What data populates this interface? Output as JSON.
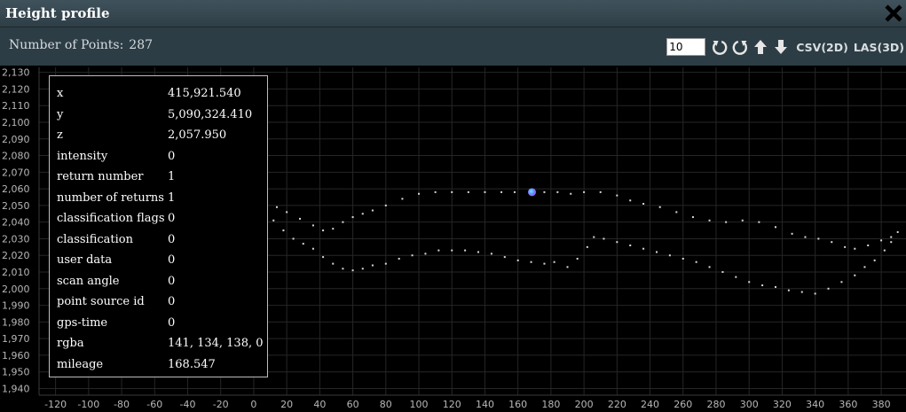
{
  "window": {
    "title": "Height profile",
    "close_icon": "close-icon"
  },
  "toolbar": {
    "points_label": "Number of Points:",
    "points_value": "287",
    "step_value": "10",
    "rotate_cw_icon": "rotate-clockwise-icon",
    "rotate_ccw_icon": "rotate-counterclockwise-icon",
    "move_up_icon": "arrow-up-icon",
    "move_down_icon": "arrow-down-icon",
    "csv_label": "CSV(2D)",
    "las_label": "LAS(3D)"
  },
  "chart_data": {
    "type": "scatter",
    "xlim": [
      -130,
      395
    ],
    "ylim": [
      1936,
      2133
    ],
    "x_ticks": [
      -120,
      -100,
      -80,
      -60,
      -40,
      -20,
      0,
      20,
      40,
      60,
      80,
      100,
      120,
      140,
      160,
      180,
      200,
      220,
      240,
      260,
      280,
      300,
      320,
      340,
      360,
      380
    ],
    "y_ticks": [
      1940,
      1950,
      1960,
      1970,
      1980,
      1990,
      2000,
      2010,
      2020,
      2030,
      2040,
      2050,
      2060,
      2070,
      2080,
      2090,
      2100,
      2110,
      2120,
      2130
    ],
    "grid": true,
    "series": [
      {
        "values": [
          [
            2,
            2067
          ],
          [
            8,
            2055
          ],
          [
            14,
            2049
          ],
          [
            20,
            2046
          ],
          [
            28,
            2042
          ],
          [
            36,
            2038
          ],
          [
            42,
            2035
          ],
          [
            48,
            2036
          ],
          [
            54,
            2040
          ],
          [
            60,
            2043
          ],
          [
            66,
            2045
          ],
          [
            72,
            2047
          ],
          [
            80,
            2050
          ],
          [
            90,
            2054
          ],
          [
            100,
            2057
          ],
          [
            110,
            2058
          ],
          [
            120,
            2058
          ],
          [
            130,
            2058
          ],
          [
            140,
            2058
          ],
          [
            150,
            2058
          ],
          [
            158,
            2058
          ],
          [
            168,
            2058
          ],
          [
            176,
            2058
          ],
          [
            184,
            2058
          ],
          [
            192,
            2057
          ],
          [
            200,
            2058
          ],
          [
            210,
            2058
          ],
          [
            220,
            2056
          ],
          [
            228,
            2053
          ],
          [
            236,
            2051
          ],
          [
            246,
            2049
          ],
          [
            256,
            2046
          ],
          [
            266,
            2043
          ],
          [
            276,
            2041
          ],
          [
            286,
            2040
          ],
          [
            296,
            2041
          ],
          [
            306,
            2040
          ],
          [
            316,
            2037
          ],
          [
            326,
            2033
          ],
          [
            334,
            2031
          ],
          [
            342,
            2030
          ],
          [
            350,
            2028
          ],
          [
            358,
            2025
          ],
          [
            364,
            2024
          ],
          [
            372,
            2026
          ],
          [
            380,
            2029
          ],
          [
            386,
            2031
          ]
        ]
      },
      {
        "values": [
          [
            6,
            2050
          ],
          [
            12,
            2041
          ],
          [
            18,
            2035
          ],
          [
            24,
            2030
          ],
          [
            30,
            2027
          ],
          [
            36,
            2024
          ],
          [
            42,
            2019
          ],
          [
            48,
            2015
          ],
          [
            54,
            2012
          ],
          [
            60,
            2011
          ],
          [
            66,
            2012
          ],
          [
            72,
            2014
          ],
          [
            80,
            2015
          ],
          [
            88,
            2018
          ],
          [
            96,
            2020
          ],
          [
            104,
            2021
          ],
          [
            112,
            2023
          ],
          [
            120,
            2023
          ],
          [
            128,
            2023
          ],
          [
            136,
            2022
          ],
          [
            144,
            2021
          ],
          [
            152,
            2019
          ],
          [
            160,
            2017
          ],
          [
            168,
            2016
          ],
          [
            176,
            2015
          ],
          [
            182,
            2016
          ],
          [
            190,
            2013
          ],
          [
            196,
            2018
          ],
          [
            202,
            2025
          ],
          [
            206,
            2031
          ],
          [
            212,
            2030
          ],
          [
            220,
            2028
          ],
          [
            228,
            2026
          ],
          [
            236,
            2024
          ],
          [
            244,
            2022
          ],
          [
            252,
            2020
          ],
          [
            260,
            2018
          ],
          [
            268,
            2016
          ],
          [
            276,
            2013
          ],
          [
            284,
            2010
          ],
          [
            292,
            2007
          ],
          [
            300,
            2004
          ],
          [
            308,
            2002
          ],
          [
            316,
            2001
          ],
          [
            324,
            1999
          ],
          [
            332,
            1998
          ],
          [
            340,
            1997
          ],
          [
            348,
            2000
          ],
          [
            356,
            2004
          ],
          [
            364,
            2008
          ],
          [
            370,
            2013
          ],
          [
            376,
            2017
          ],
          [
            382,
            2023
          ],
          [
            386,
            2028
          ],
          [
            390,
            2034
          ]
        ]
      }
    ],
    "highlight_point": [
      168.5,
      2058
    ]
  },
  "info": {
    "rows": [
      {
        "label": "x",
        "value": "415,921.540"
      },
      {
        "label": "y",
        "value": "5,090,324.410"
      },
      {
        "label": "z",
        "value": "2,057.950"
      },
      {
        "label": "intensity",
        "value": "0"
      },
      {
        "label": "return number",
        "value": "1"
      },
      {
        "label": "number of returns",
        "value": "1"
      },
      {
        "label": "classification flags",
        "value": "0"
      },
      {
        "label": "classification",
        "value": "0"
      },
      {
        "label": "user data",
        "value": "0"
      },
      {
        "label": "scan angle",
        "value": "0"
      },
      {
        "label": "point source id",
        "value": "0"
      },
      {
        "label": "gps-time",
        "value": "0"
      },
      {
        "label": "rgba",
        "value": "141, 134, 138, 0"
      },
      {
        "label": "mileage",
        "value": "168.547"
      }
    ]
  },
  "colors": {
    "titlebar": "#364750",
    "toolbar": "#2d3d45",
    "plot_bg": "#000000",
    "grid": "#262626",
    "point": "#d8d8d8",
    "highlight": "#9b59f0"
  }
}
